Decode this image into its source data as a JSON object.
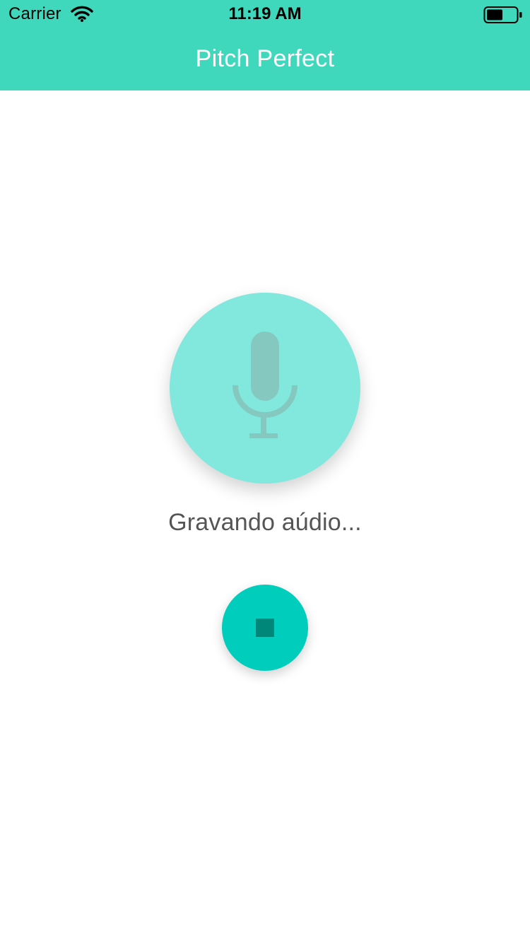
{
  "status_bar": {
    "carrier": "Carrier",
    "time": "11:19 AM",
    "wifi_icon": "wifi-icon",
    "battery_icon": "battery-icon"
  },
  "nav": {
    "title": "Pitch Perfect"
  },
  "record": {
    "icon": "microphone-icon",
    "status_text": "Gravando aúdio..."
  },
  "stop": {
    "icon": "stop-icon"
  },
  "colors": {
    "header_bg": "#3fd8bc",
    "record_button_bg": "#82e7dd",
    "mic_icon": "#84c8bf",
    "stop_button_bg": "#00cdbc",
    "stop_icon": "#00877a",
    "status_text": "#555555"
  }
}
